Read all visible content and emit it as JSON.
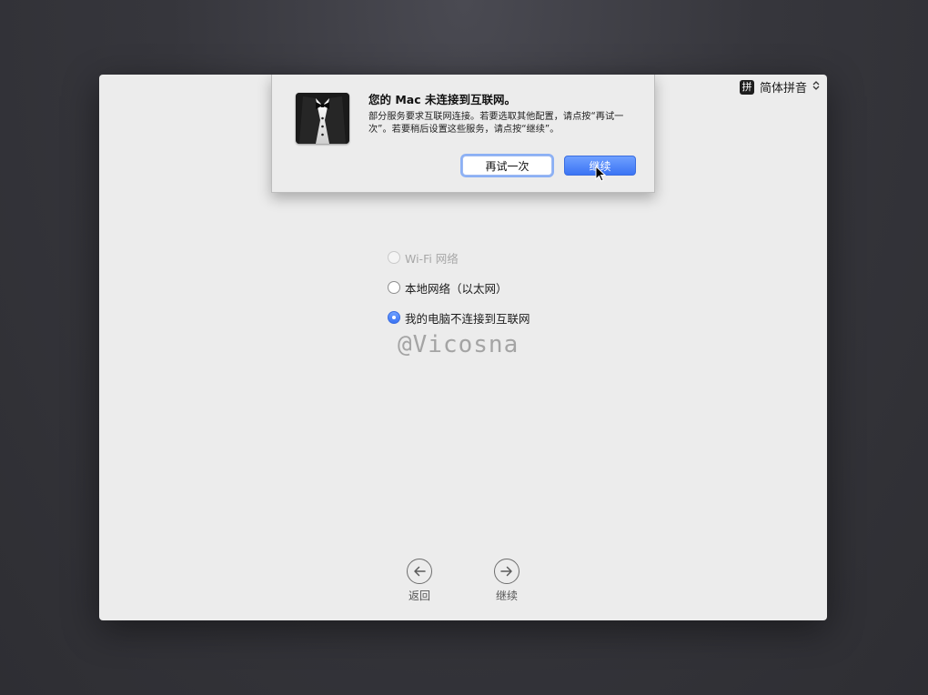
{
  "input_menu": {
    "badge": "拼",
    "label": "简体拼音",
    "arrows": "⌃⌄"
  },
  "alert": {
    "title": "您的 Mac 未连接到互联网。",
    "message": "部分服务要求互联网连接。若要选取其他配置，请点按“再试一次”。若要稍后设置这些服务，请点按“继续”。",
    "buttons": {
      "retry": "再试一次",
      "continue": "继续"
    }
  },
  "network_options": [
    {
      "label": "Wi-Fi 网络",
      "enabled": false,
      "selected": false
    },
    {
      "label": "本地网络（以太网）",
      "enabled": true,
      "selected": false
    },
    {
      "label": "我的电脑不连接到互联网",
      "enabled": true,
      "selected": true
    }
  ],
  "watermark": "@Vicosna",
  "nav": {
    "back_label": "返回",
    "next_label": "继续"
  },
  "colors": {
    "accent": "#3b74f4",
    "window_bg": "#ececec",
    "desktop_bg": "#36363c"
  }
}
